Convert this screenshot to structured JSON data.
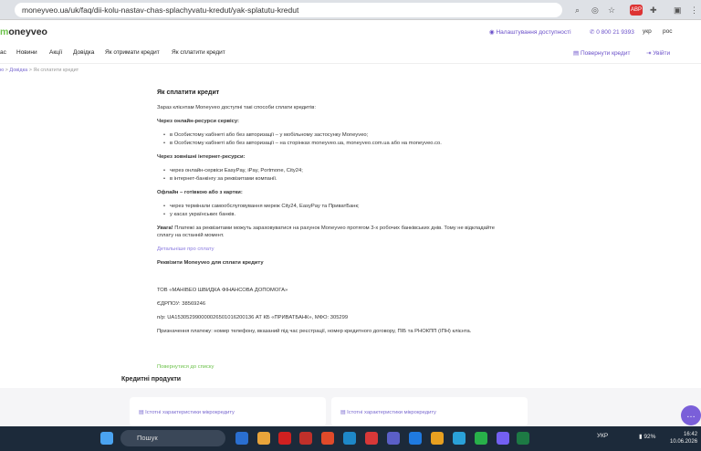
{
  "browser": {
    "url": "moneyveo.ua/uk/faq/dii-kolu-nastav-chas-splachyvatu-kredut/yak-splatutu-kredut",
    "ext_badge": "ABP"
  },
  "header": {
    "logo_prefix": "m",
    "logo_rest": "oneyveo",
    "accessibility": "Налаштування доступності",
    "phone": "0 800 21 9393",
    "lang_uk": "укр",
    "lang_ru": "рос"
  },
  "nav": {
    "items": [
      "ас",
      "Новини",
      "Акції",
      "Довідка",
      "Як отримати кредит",
      "Як сплатити кредит"
    ],
    "return_credit": "Повернути кредит",
    "login": "Увійти"
  },
  "breadcrumb": {
    "home": "ю",
    "sep": ">",
    "faq": "Довідка",
    "current": "Як сплатити кредит"
  },
  "article": {
    "title": "Як сплатити кредит",
    "intro": "Зараз клієнтам Moneyveo доступні такі способи сплати кредитів:",
    "s1_title": "Через онлайн-ресурси сервісу:",
    "s1_items": [
      "в Особистому кабінеті або без авторизації – у мобільному застосунку Moneyveo;",
      "в Особистому кабінеті або без авторизації – на сторінках moneyveo.ua, moneyveo.com.ua або на moneyveo.co."
    ],
    "s2_title": "Через зовнішні інтернет-ресурси:",
    "s2_items": [
      "через онлайн-сервіси EasyPay, iPay, Portmone, City24;",
      "в інтернет-банкінгу за реквізитами компанії."
    ],
    "s3_title": "Офлайн – готівкою або з картки:",
    "s3_items": [
      "через термінали самообслуговування мереж City24, EasyPay та ПриватБанк;",
      "у касах українських банків."
    ],
    "warn_bold": "Увага!",
    "warn_text": " Платежі за реквізитами можуть зараховуватися на рахунок Moneyveo протягом 3-х робочих банківських днів. Тому не відкладайте сплату на останній момент.",
    "more_link": "Детальніше про сплату",
    "req_title": "Реквізити Moneyveo для сплати кредиту",
    "company": "ТОВ «МАНІВЕО ШВИДКА ФІНАНСОВА ДОПОМОГА»",
    "edrpou": "ЄДРПОУ: 38569246",
    "account": "п/р: UA153052990000026501016200136 АТ КБ «ПРИВАТБАНК», МФО: 305299",
    "purpose": "Призначення платежу: номер телефону, вказаний під час реєстрації, номер кредитного договору, ПІБ та РНОКПП (ІПН) клієнта."
  },
  "back_link": "Повернутися до списку",
  "products": {
    "title": "Кредитні продукти",
    "cards": [
      "Істотні характеристики мікрокредиту",
      "Істотні характеристики мікрокредиту"
    ]
  },
  "taskbar": {
    "search": "Пошук",
    "lang": "УКР",
    "battery": "92%",
    "time": "16:42",
    "date": "10.06.2026"
  }
}
